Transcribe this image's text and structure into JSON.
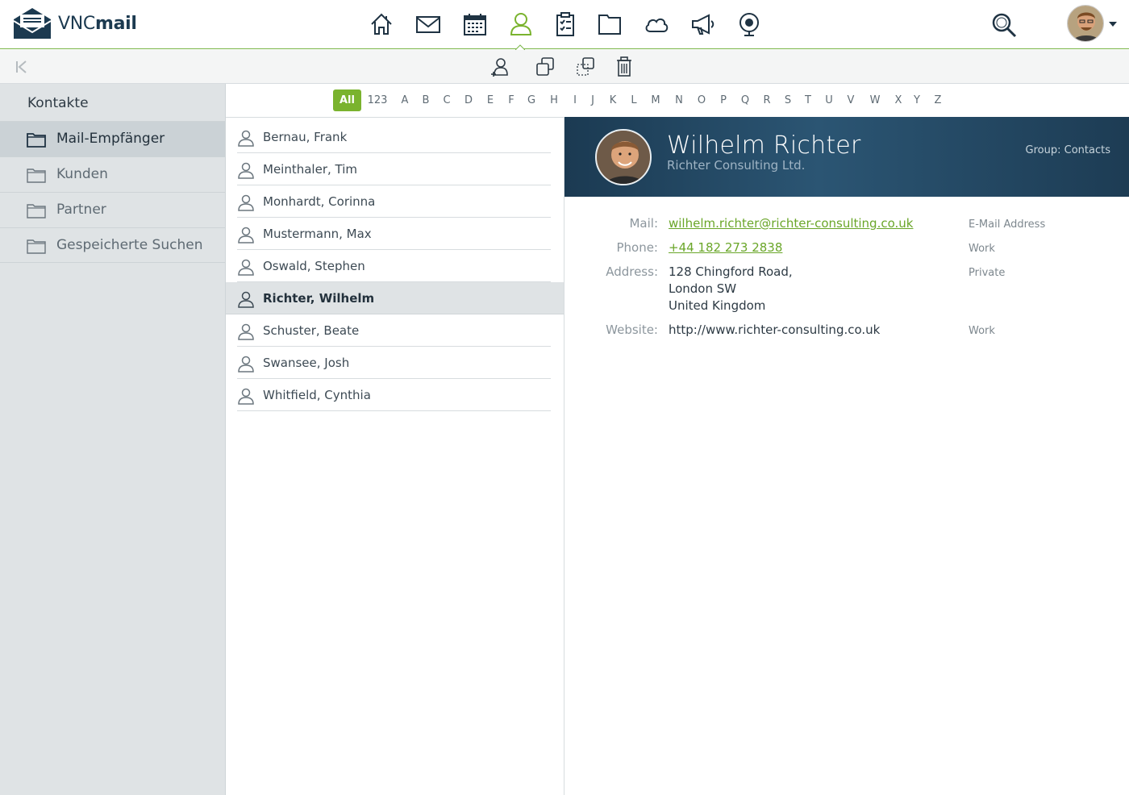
{
  "brand": {
    "prefix": "VNC",
    "suffix": "mail"
  },
  "apps": [
    {
      "name": "home",
      "active": false
    },
    {
      "name": "mail",
      "active": false
    },
    {
      "name": "calendar",
      "active": false
    },
    {
      "name": "contacts",
      "active": true
    },
    {
      "name": "tasks",
      "active": false
    },
    {
      "name": "files",
      "active": false
    },
    {
      "name": "cloud",
      "active": false
    },
    {
      "name": "announcements",
      "active": false
    },
    {
      "name": "video",
      "active": false
    }
  ],
  "colors": {
    "accent": "#7ab32e",
    "header_dark": "#1b3a52",
    "link": "#6aa629"
  },
  "sidebar": {
    "title": "Kontakte",
    "items": [
      {
        "label": "Mail-Empfänger",
        "selected": true
      },
      {
        "label": "Kunden",
        "selected": false
      },
      {
        "label": "Partner",
        "selected": false
      },
      {
        "label": "Gespeicherte Suchen",
        "selected": false
      }
    ]
  },
  "alphabet": [
    "All",
    "123",
    "A",
    "B",
    "C",
    "D",
    "E",
    "F",
    "G",
    "H",
    "I",
    "J",
    "K",
    "L",
    "M",
    "N",
    "O",
    "P",
    "Q",
    "R",
    "S",
    "T",
    "U",
    "V",
    "W",
    "X",
    "Y",
    "Z"
  ],
  "alphabet_active": "All",
  "contacts": [
    {
      "name": "Bernau, Frank",
      "selected": false
    },
    {
      "name": "Meinthaler, Tim",
      "selected": false
    },
    {
      "name": "Monhardt, Corinna",
      "selected": false
    },
    {
      "name": "Mustermann, Max",
      "selected": false
    },
    {
      "name": "Oswald, Stephen",
      "selected": false
    },
    {
      "name": "Richter, Wilhelm",
      "selected": true
    },
    {
      "name": "Schuster, Beate",
      "selected": false
    },
    {
      "name": "Swansee, Josh",
      "selected": false
    },
    {
      "name": "Whitfield, Cynthia",
      "selected": false
    }
  ],
  "detail": {
    "name": "Wilhelm Richter",
    "company": "Richter Consulting Ltd.",
    "group": "Group: Contacts",
    "fields": {
      "mail": {
        "label": "Mail:",
        "value": "wilhelm.richter@richter-consulting.co.uk",
        "type": "E-Mail Address"
      },
      "phone": {
        "label": "Phone:",
        "value": "+44 182 273 2838",
        "type": "Work"
      },
      "address": {
        "label": "Address:",
        "lines": [
          "128 Chingford Road,",
          "London SW",
          "United Kingdom"
        ],
        "type": "Private"
      },
      "website": {
        "label": "Website:",
        "value": "http://www.richter-consulting.co.uk",
        "type": "Work"
      }
    }
  }
}
